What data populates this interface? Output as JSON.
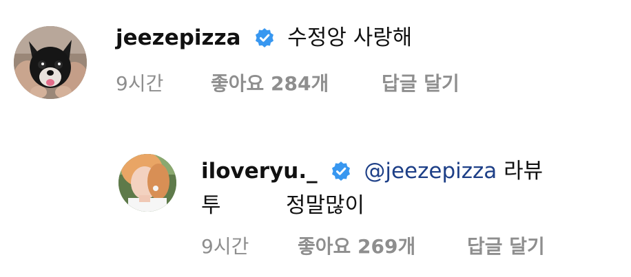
{
  "colors": {
    "text": "#111111",
    "meta": "#8e8e8e",
    "mention": "#1d3f87",
    "verified": "#3897f0"
  },
  "comments": [
    {
      "username": "jeezepizza",
      "verified": true,
      "text": "수정앙 사랑해",
      "time": "9시간",
      "likes": "좋아요 284개",
      "reply": "답글 달기",
      "avatar_icon": "chihuahua-photo"
    },
    {
      "username": "iloveryu._",
      "verified": true,
      "mention": "@jeezepizza",
      "text_line1": "라뷰",
      "text_line2a": "투",
      "text_line2b": "정말많이",
      "time": "9시간",
      "likes": "좋아요 269개",
      "reply": "답글 달기",
      "avatar_icon": "person-photo"
    }
  ]
}
